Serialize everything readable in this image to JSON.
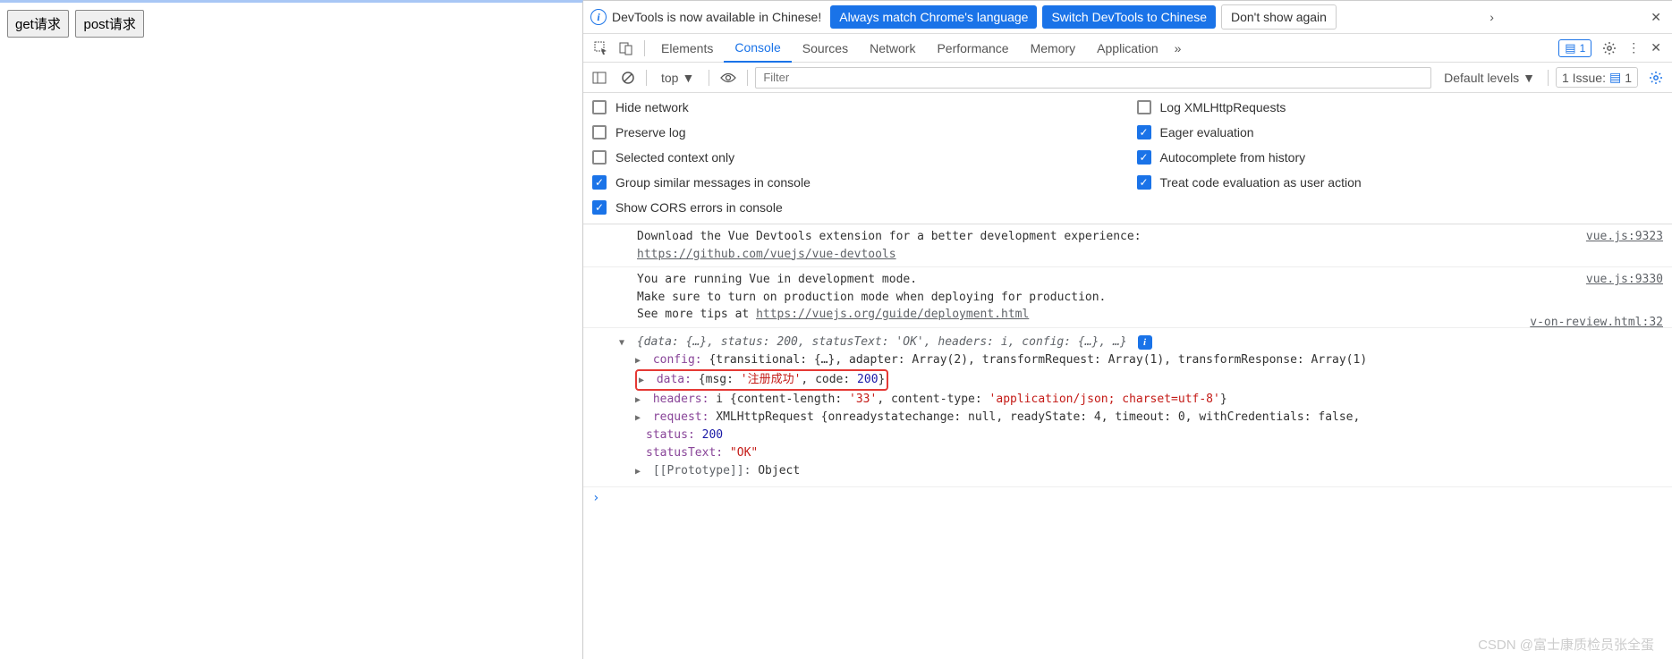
{
  "left": {
    "get_btn": "get请求",
    "post_btn": "post请求"
  },
  "lang_bar": {
    "message": "DevTools is now available in Chinese!",
    "always_match": "Always match Chrome's language",
    "switch": "Switch DevTools to Chinese",
    "dont_show": "Don't show again"
  },
  "tabs": {
    "elements": "Elements",
    "console": "Console",
    "sources": "Sources",
    "network": "Network",
    "performance": "Performance",
    "memory": "Memory",
    "application": "Application",
    "badge_count": "1"
  },
  "filter": {
    "context": "top",
    "filter_placeholder": "Filter",
    "default_levels": "Default levels",
    "issue_label": "1 Issue:",
    "issue_count": "1"
  },
  "settings": {
    "hide_network": {
      "label": "Hide network",
      "checked": false
    },
    "log_xhr": {
      "label": "Log XMLHttpRequests",
      "checked": false
    },
    "preserve_log": {
      "label": "Preserve log",
      "checked": false
    },
    "eager_eval": {
      "label": "Eager evaluation",
      "checked": true
    },
    "selected_ctx": {
      "label": "Selected context only",
      "checked": false
    },
    "autocomplete": {
      "label": "Autocomplete from history",
      "checked": true
    },
    "group_similar": {
      "label": "Group similar messages in console",
      "checked": true
    },
    "treat_eval": {
      "label": "Treat code evaluation as user action",
      "checked": true
    },
    "show_cors": {
      "label": "Show CORS errors in console",
      "checked": true
    }
  },
  "logs": {
    "vue1": {
      "text": "Download the Vue Devtools extension for a better development experience:",
      "link": "https://github.com/vuejs/vue-devtools",
      "src": "vue.js:9323"
    },
    "vue2": {
      "line1": "You are running Vue in development mode.",
      "line2": "Make sure to turn on production mode when deploying for production.",
      "line3_pre": "See more tips at ",
      "link": "https://vuejs.org/guide/deployment.html",
      "src": "vue.js:9330"
    },
    "obj": {
      "src": "v-on-review.html:32",
      "summary": "{data: {…}, status: 200, statusText: 'OK', headers: i, config: {…}, …}",
      "config_key": "config: ",
      "config_val": "{transitional: {…}, adapter: Array(2), transformRequest: Array(1), transformResponse: Array(1)",
      "data_key": "data: ",
      "data_msg_key": "{msg: ",
      "data_msg_val": "'注册成功'",
      "data_code_key": ", code: ",
      "data_code_val": "200",
      "data_close": "}",
      "headers_key": "headers: ",
      "headers_pre": "i {content-length: ",
      "headers_len": "'33'",
      "headers_mid": ", content-type: ",
      "headers_ct": "'application/json; charset=utf-8'",
      "headers_close": "}",
      "request_key": "request: ",
      "request_val": "XMLHttpRequest {onreadystatechange: null, readyState: 4, timeout: 0, withCredentials: false,",
      "status_key": "status: ",
      "status_val": "200",
      "statusText_key": "statusText: ",
      "statusText_val": "\"OK\"",
      "proto_key": "[[Prototype]]: ",
      "proto_val": "Object"
    }
  },
  "watermark": "CSDN @富士康质检员张全蛋"
}
